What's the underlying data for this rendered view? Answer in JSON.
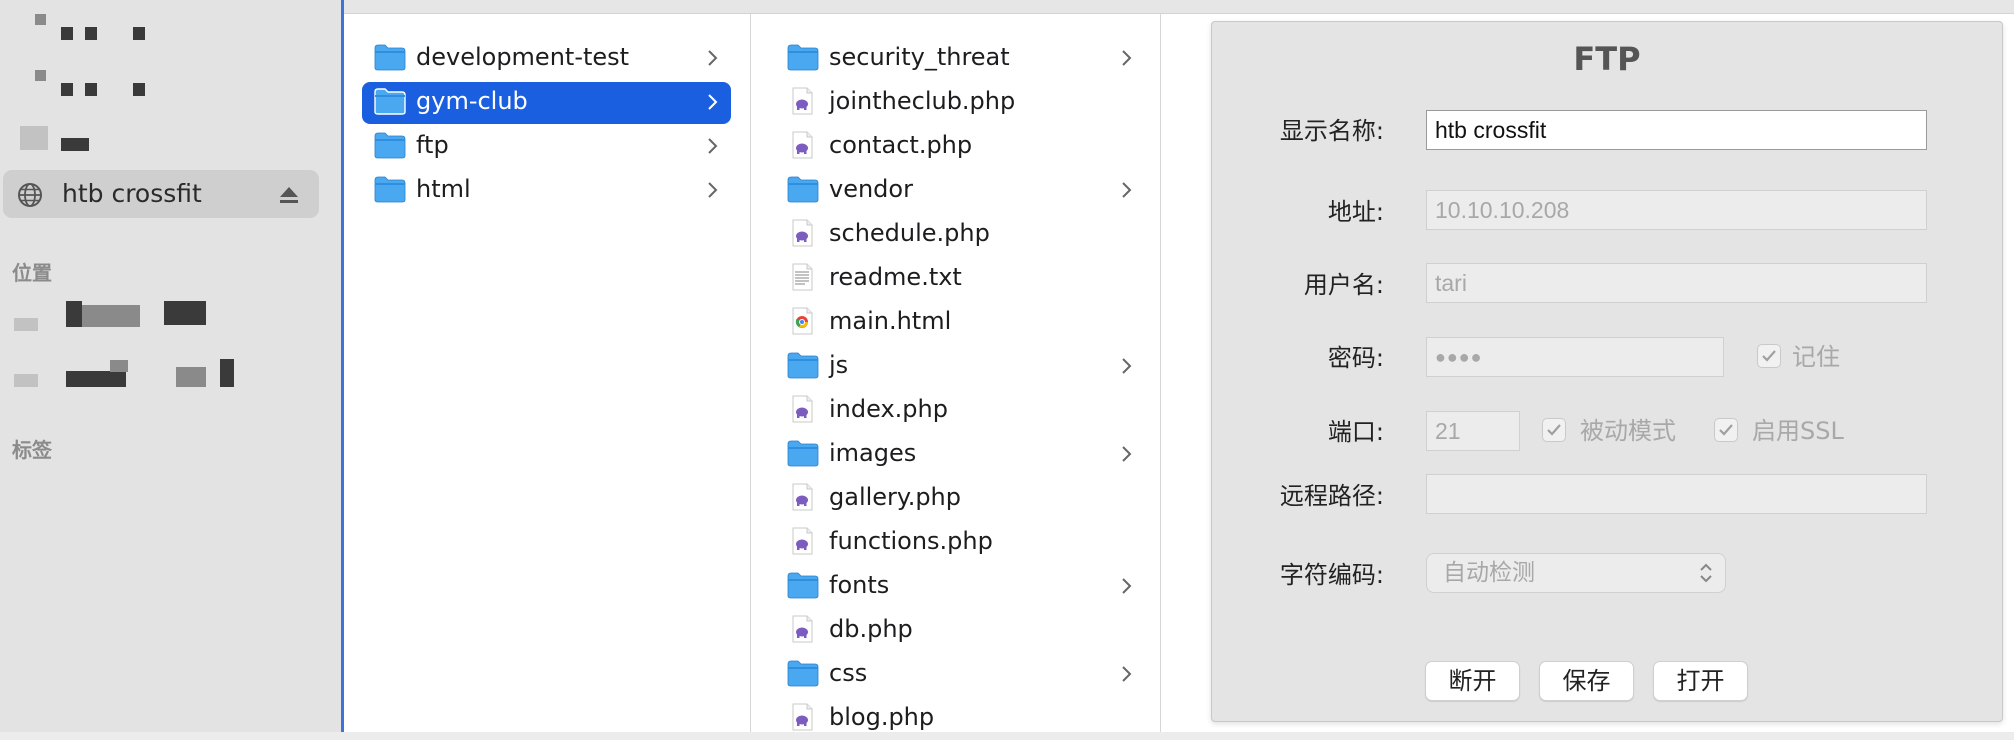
{
  "sidebar": {
    "server_name": "htb crossfit",
    "locations_header": "位置",
    "tags_header": "标签"
  },
  "columns": {
    "col1": [
      {
        "name": "development-test",
        "type": "folder",
        "has_children": true
      },
      {
        "name": "gym-club",
        "type": "folder",
        "has_children": true,
        "selected": true
      },
      {
        "name": "ftp",
        "type": "folder",
        "has_children": true
      },
      {
        "name": "html",
        "type": "folder",
        "has_children": true
      }
    ],
    "col2": [
      {
        "name": "security_threat",
        "type": "folder",
        "has_children": true
      },
      {
        "name": "jointheclub.php",
        "type": "php"
      },
      {
        "name": "contact.php",
        "type": "php"
      },
      {
        "name": "vendor",
        "type": "folder",
        "has_children": true
      },
      {
        "name": "schedule.php",
        "type": "php"
      },
      {
        "name": "readme.txt",
        "type": "txt"
      },
      {
        "name": "main.html",
        "type": "html"
      },
      {
        "name": "js",
        "type": "folder",
        "has_children": true
      },
      {
        "name": "index.php",
        "type": "php"
      },
      {
        "name": "images",
        "type": "folder",
        "has_children": true
      },
      {
        "name": "gallery.php",
        "type": "php"
      },
      {
        "name": "functions.php",
        "type": "php"
      },
      {
        "name": "fonts",
        "type": "folder",
        "has_children": true
      },
      {
        "name": "db.php",
        "type": "php"
      },
      {
        "name": "css",
        "type": "folder",
        "has_children": true
      },
      {
        "name": "blog.php",
        "type": "php"
      }
    ]
  },
  "dialog": {
    "title": "FTP",
    "display_name_label": "显示名称:",
    "display_name_value": "htb crossfit",
    "address_label": "地址:",
    "address_value": "10.10.10.208",
    "username_label": "用户名:",
    "username_value": "tari",
    "password_label": "密码:",
    "password_value": "●●●●",
    "remember_label": "记住",
    "remember_checked": true,
    "port_label": "端口:",
    "port_value": "21",
    "passive_label": "被动模式",
    "passive_checked": true,
    "ssl_label": "启用SSL",
    "ssl_checked": true,
    "remote_path_label": "远程路径:",
    "remote_path_value": "",
    "encoding_label": "字符编码:",
    "encoding_value": "自动检测",
    "disconnect_label": "断开",
    "save_label": "保存",
    "open_label": "打开"
  },
  "colors": {
    "selection": "#1a5fe0",
    "folder": "#4aa8f0",
    "php_icon": "#7c5cbf"
  }
}
